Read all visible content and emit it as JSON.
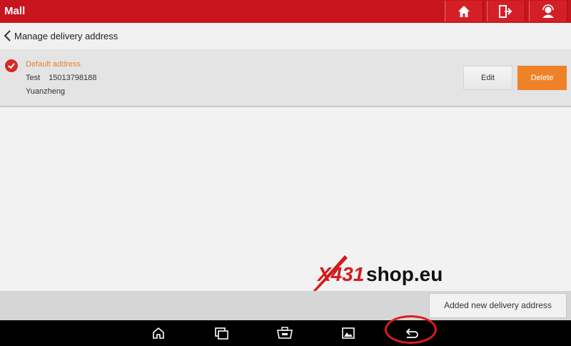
{
  "topbar": {
    "title": "Mall",
    "buttons": [
      {
        "icon": "home-icon"
      },
      {
        "icon": "exit-icon"
      },
      {
        "icon": "user-support-icon"
      }
    ]
  },
  "subheader": {
    "back_icon": "chevron-left-icon",
    "title": "Manage delivery address"
  },
  "address": {
    "default_label": "Default address",
    "name": "Test",
    "phone": "15013798188",
    "address_line": "Yuanzheng",
    "selected_icon": "check-circle-icon",
    "edit_label": "Edit",
    "delete_label": "Delete"
  },
  "footer": {
    "add_button_label": "Added new delivery address"
  },
  "watermark": {
    "brand": "X431shop.eu",
    "part1": "X431",
    "part2": "shop.eu"
  },
  "navbar": {
    "buttons": [
      {
        "icon": "home-outline-icon"
      },
      {
        "icon": "recent-apps-icon"
      },
      {
        "icon": "vci-connector-icon"
      },
      {
        "icon": "gallery-icon"
      },
      {
        "icon": "back-arrow-icon"
      }
    ]
  },
  "colors": {
    "brand_red": "#c8151d",
    "accent_orange": "#ef8228",
    "default_label_orange": "#e98030",
    "highlight_ring": "#e21a1a"
  }
}
